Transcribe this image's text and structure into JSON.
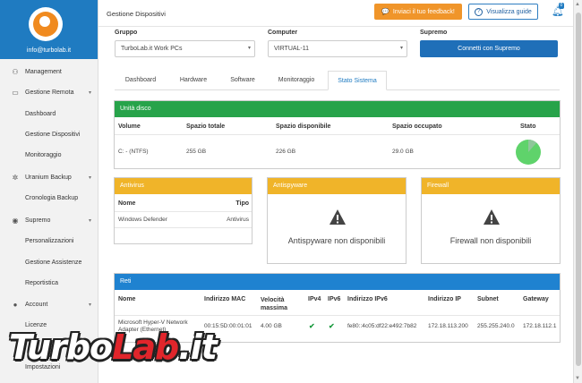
{
  "app": {
    "email": "info@turbolab.it",
    "page_title": "Gestione Dispositivi"
  },
  "topbar": {
    "feedback_label": "Inviaci il tuo feedback!",
    "guide_label": "Visualizza guide",
    "notification_count": "0"
  },
  "sidebar": {
    "items": [
      {
        "label": "Management",
        "icon": "sitemap-icon"
      },
      {
        "label": "Gestione Remota",
        "icon": "monitor-icon"
      },
      {
        "label": "Uranium Backup",
        "icon": "backup-icon"
      },
      {
        "label": "Supremo",
        "icon": "supremo-icon"
      },
      {
        "label": "Account",
        "icon": "user-icon"
      }
    ],
    "sub": {
      "remote": [
        "Dashboard",
        "Gestione Dispositivi",
        "Monitoraggio"
      ],
      "backup": [
        "Cronologia Backup"
      ],
      "supremo": [
        "Personalizzazioni",
        "Gestione Assistenze",
        "Reportistica"
      ],
      "account": [
        "Licenze",
        "Impostazioni"
      ]
    }
  },
  "selectors": {
    "group_label": "Gruppo",
    "group_value": "TurboLab.it Work PCs",
    "computer_label": "Computer",
    "computer_value": "VIRTUAL-11",
    "supremo_label": "Supremo",
    "connect_label": "Connetti con Supremo"
  },
  "tabs": [
    "Dashboard",
    "Hardware",
    "Software",
    "Monitoraggio",
    "Stato Sistema"
  ],
  "active_tab": "Stato Sistema",
  "disks": {
    "title": "Unità disco",
    "headers": [
      "Volume",
      "Spazio totale",
      "Spazio disponibile",
      "Spazio occupato",
      "Stato"
    ],
    "rows": [
      [
        "C: - (NTFS)",
        "255 GB",
        "226 GB",
        "29.0 GB"
      ]
    ],
    "used_fraction": 0.114
  },
  "antivirus": {
    "title": "Antivirus",
    "headers": [
      "Nome",
      "Tipo"
    ],
    "rows": [
      [
        "Windows Defender",
        "Antivirus"
      ]
    ]
  },
  "antispyware": {
    "title": "Antispyware",
    "message": "Antispyware non disponibili"
  },
  "firewall": {
    "title": "Firewall",
    "message": "Firewall non disponibili"
  },
  "networks": {
    "title": "Reti",
    "headers": [
      "Nome",
      "Indirizzo MAC",
      "Velocità massima",
      "IPv4",
      "IPv6",
      "Indirizzo IPv6",
      "Indirizzo IP",
      "Subnet",
      "Gateway"
    ],
    "rows": [
      [
        "Microsoft Hyper-V Network Adapter (Ethernet)",
        "00:15:5D:00:01:01",
        "4.00 GB",
        "✔",
        "✔",
        "fe80::4c05:df22:e492:7b82",
        "172.18.113.200",
        "255.255.240.0",
        "172.18.112.1"
      ]
    ]
  },
  "watermark": "TurboLab.it",
  "colors": {
    "primary": "#1f7bc1",
    "success": "#27a34a",
    "warning": "#f0b429",
    "orange": "#f08a1f"
  }
}
